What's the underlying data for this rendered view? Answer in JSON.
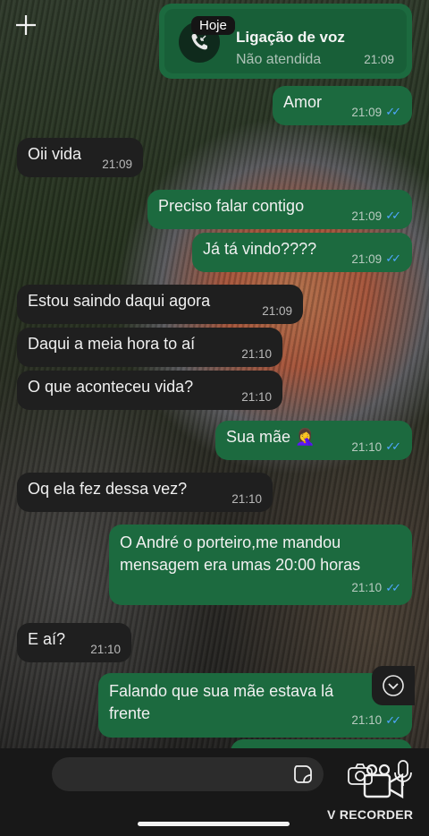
{
  "date_chip": "Hoje",
  "call": {
    "title": "Ligação de voz",
    "status": "Não atendida",
    "time": "21:09"
  },
  "messages": [
    {
      "dir": "out",
      "text": "Amor",
      "time": "21:09"
    },
    {
      "dir": "in",
      "text": "Oii vida",
      "time": "21:09"
    },
    {
      "dir": "out",
      "text": "Preciso falar contigo",
      "time": "21:09"
    },
    {
      "dir": "out",
      "text": "Já tá vindo????",
      "time": "21:09"
    },
    {
      "dir": "in",
      "text": "Estou saindo daqui agora",
      "time": "21:09"
    },
    {
      "dir": "in",
      "text": "Daqui a meia hora to aí",
      "time": "21:10"
    },
    {
      "dir": "in",
      "text": "O que aconteceu vida?",
      "time": "21:10"
    },
    {
      "dir": "out",
      "text": "Sua mãe 🤦‍♀️",
      "time": "21:10"
    },
    {
      "dir": "in",
      "text": "Oq ela fez dessa vez?",
      "time": "21:10"
    },
    {
      "dir": "out",
      "text_line1": "O André o porteiro,me mandou",
      "text_line2": "mensagem era umas 20:00 horas",
      "time": "21:10"
    },
    {
      "dir": "in",
      "text": "E aí?",
      "time": "21:10"
    },
    {
      "dir": "out",
      "text_line1": "Falando que  sua mãe estava lá",
      "text_line2": "frente",
      "time": "21:10"
    }
  ],
  "watermark": "V RECORDER",
  "colors": {
    "outgoing": "#1c6a3f",
    "incoming": "#1f1f1f",
    "read_ticks": "#4fa7ff"
  }
}
